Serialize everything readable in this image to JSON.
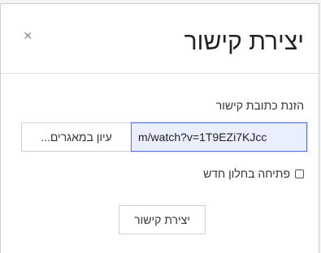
{
  "dialog": {
    "title": "יצירת קישור",
    "close_glyph": "×",
    "close_icon": "close-icon"
  },
  "form": {
    "url_label": "הזנת כתובת קישור",
    "url_value": "m/watch?v=1T9EZi7KJcc",
    "browse_label": "עיון במאגרים...",
    "new_window_label": "פתיחה בחלון חדש",
    "new_window_checked": false,
    "submit_label": "יצירת קישור"
  },
  "colors": {
    "input_border_focus": "#5b73e8",
    "input_background": "#e9efff"
  }
}
